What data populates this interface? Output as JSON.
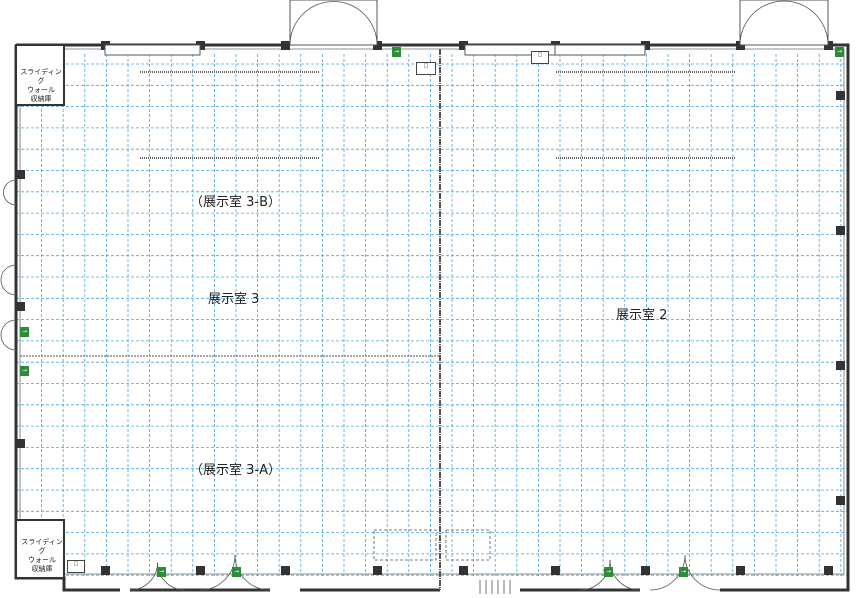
{
  "rooms": {
    "room_3b": "（展示室 3-B）",
    "room_3": "展示室 3",
    "room_3a": "（展示室 3-A）",
    "room_2": "展示室 2"
  },
  "storage": {
    "top_left": "スライディング\nウォール\n収納庫",
    "bottom_left": "スライディング\nウォール\n収納庫"
  },
  "exit_sign_glyph": "→",
  "small_box_label": "□",
  "colors": {
    "grid": "#49a7d8",
    "wall": "#333333",
    "exit": "#2e8b3a"
  }
}
